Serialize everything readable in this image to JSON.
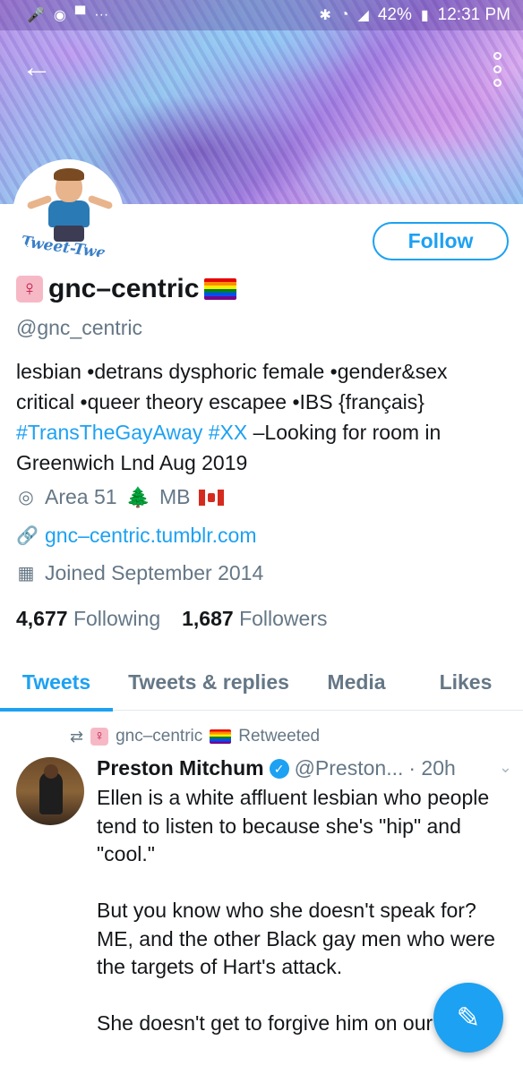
{
  "status_bar": {
    "battery": "42%",
    "time": "12:31 PM",
    "left_icons": [
      "mic-icon",
      "account-icon",
      "chat-icon",
      "more-icon"
    ],
    "right_icons": [
      "bluetooth-icon",
      "wifi-icon",
      "signal-icon",
      "battery-icon"
    ]
  },
  "header": {
    "back_icon": "arrow-left-icon",
    "more_icon": "more-vertical-icon"
  },
  "avatar": {
    "logo_text": "Tweet-Tweet"
  },
  "profile": {
    "follow_label": "Follow",
    "name": "gnc–centric",
    "handle": "@gnc_centric",
    "bio": {
      "line1": "lesbian •detrans dysphoric female •gender&sex critical •queer theory escapee •IBS {français}",
      "tag1": "#TransTheGayAway",
      "tag2": "#XX",
      "line2": " –Looking for room in Greenwich Lnd Aug 2019"
    },
    "location": "Area 51",
    "location_suffix": "MB",
    "website": "gnc–centric.tumblr.com",
    "joined": "Joined September 2014",
    "following_count": "4,677",
    "following_label": "Following",
    "followers_count": "1,687",
    "followers_label": "Followers"
  },
  "tabs": [
    {
      "label": "Tweets",
      "active": true
    },
    {
      "label": "Tweets & replies",
      "active": false
    },
    {
      "label": "Media",
      "active": false
    },
    {
      "label": "Likes",
      "active": false
    }
  ],
  "tweet": {
    "retweeted_by": "gnc–centric",
    "retweeted_label": "Retweeted",
    "author_name": "Preston Mitchum",
    "author_handle": "@Preston...",
    "time": "· 20h",
    "body": [
      "Ellen is a white affluent lesbian who people tend to listen to because she's \"hip\" and \"cool.\"",
      "But you know who she doesn't speak for? ME, and the other Black gay men who were the targets of Hart's attack.",
      "She doesn't get to forgive him on our behalf."
    ]
  },
  "colors": {
    "accent": "#1da1f2",
    "secondary_text": "#657786",
    "primary_text": "#14171a"
  }
}
